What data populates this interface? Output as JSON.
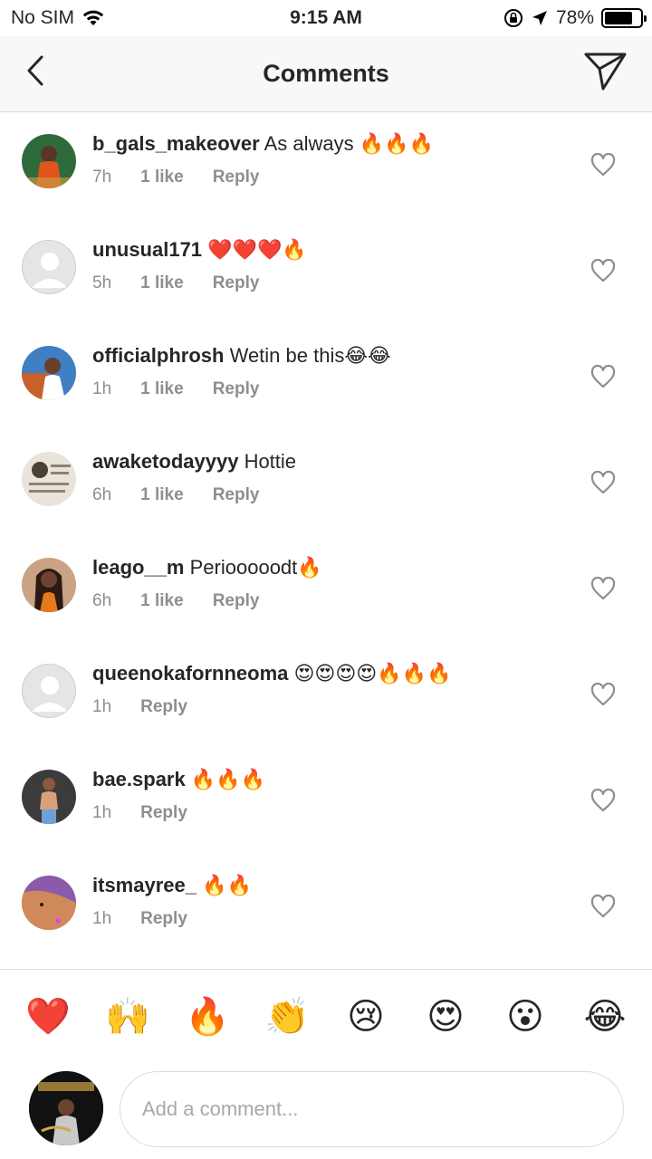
{
  "status_bar": {
    "carrier": "No SIM",
    "time": "9:15 AM",
    "battery": "78%",
    "battery_level": 0.78
  },
  "header": {
    "title": "Comments"
  },
  "comments": [
    {
      "username": "b_gals_makeover",
      "text": "As always 🔥🔥🔥",
      "time": "7h",
      "likes": "1 like",
      "reply": "Reply"
    },
    {
      "username": "unusual171",
      "text": "❤️❤️❤️🔥",
      "time": "5h",
      "likes": "1 like",
      "reply": "Reply"
    },
    {
      "username": "officialphrosh",
      "text": "Wetin be this😂😂",
      "time": "1h",
      "likes": "1 like",
      "reply": "Reply"
    },
    {
      "username": "awaketodayyyy",
      "text": "Hottie",
      "time": "6h",
      "likes": "1 like",
      "reply": "Reply"
    },
    {
      "username": "leago__m",
      "text": "Periooooodt🔥",
      "time": "6h",
      "likes": "1 like",
      "reply": "Reply"
    },
    {
      "username": "queenokafornneoma",
      "text": "😍😍😍😍🔥🔥🔥",
      "time": "1h",
      "likes": "",
      "reply": "Reply"
    },
    {
      "username": "bae.spark",
      "text": "🔥🔥🔥",
      "time": "1h",
      "likes": "",
      "reply": "Reply"
    },
    {
      "username": "itsmayree_",
      "text": "🔥🔥",
      "time": "1h",
      "likes": "",
      "reply": "Reply"
    }
  ],
  "quick_emojis": [
    "❤️",
    "🙌",
    "🔥",
    "👏",
    "😢",
    "😍",
    "😮",
    "😂"
  ],
  "composer": {
    "placeholder": "Add a comment..."
  },
  "icons": {
    "back": "chevron-left-icon",
    "send": "paper-plane-icon",
    "heart": "heart-outline-icon",
    "wifi": "wifi-icon",
    "location": "location-arrow-icon",
    "lock": "orientation-lock-icon"
  }
}
